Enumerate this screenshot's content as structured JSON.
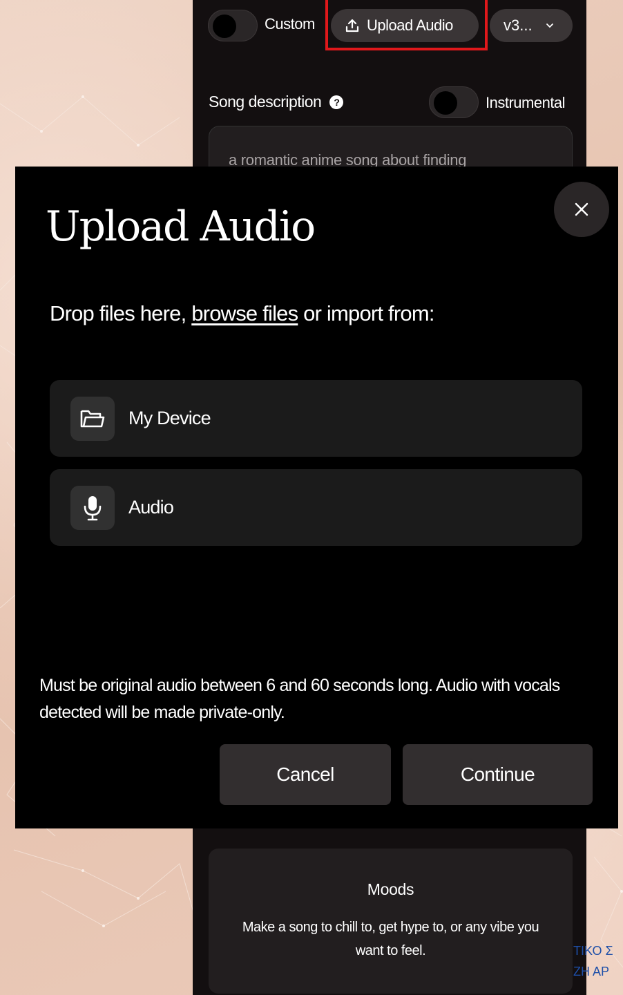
{
  "app": {
    "custom_label": "Custom",
    "upload_audio_label": "Upload Audio",
    "version_label": "v3...",
    "song_description_label": "Song description",
    "instrumental_label": "Instrumental",
    "description_text": "a romantic anime song about finding",
    "moods": {
      "title": "Moods",
      "text": "Make a song to chill to, get hype to, or any vibe you want to feel."
    },
    "edge_text_1": "ΤΙΚΟ Σ",
    "edge_text_2": "ΖΗ ΑΡ"
  },
  "modal": {
    "title": "Upload Audio",
    "drop_prefix": "Drop files here,",
    "browse_link": "browse files",
    "drop_suffix": "or import from:",
    "sources": [
      {
        "label": "My Device",
        "icon": "folder-icon"
      },
      {
        "label": "Audio",
        "icon": "microphone-icon"
      }
    ],
    "notice": "Must be original audio between 6 and 60 seconds long. Audio with vocals detected will be made private-only.",
    "cancel_label": "Cancel",
    "continue_label": "Continue"
  },
  "colors": {
    "highlight": "#e0181b",
    "panel_bg": "#130f10",
    "modal_bg": "#000000",
    "page_bg": "#e9c9b8"
  }
}
